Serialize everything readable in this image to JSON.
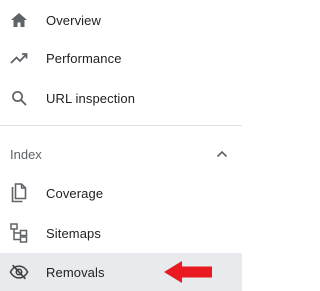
{
  "nav": {
    "items_top": [
      {
        "label": "Overview",
        "icon": "home-icon"
      },
      {
        "label": "Performance",
        "icon": "trending-up-icon"
      },
      {
        "label": "URL inspection",
        "icon": "search-icon"
      }
    ],
    "index_section": {
      "label": "Index",
      "collapse_icon": "chevron-up-icon",
      "items": [
        {
          "label": "Coverage",
          "icon": "file-copy-icon"
        },
        {
          "label": "Sitemaps",
          "icon": "sitemap-icon"
        },
        {
          "label": "Removals",
          "icon": "eye-off-icon",
          "active": true
        }
      ]
    }
  },
  "colors": {
    "icon": "#5f6368",
    "text": "#202124",
    "active_bg": "#e8eaed",
    "divider": "#e0e0e0",
    "annotation_arrow": "#e8191f"
  }
}
